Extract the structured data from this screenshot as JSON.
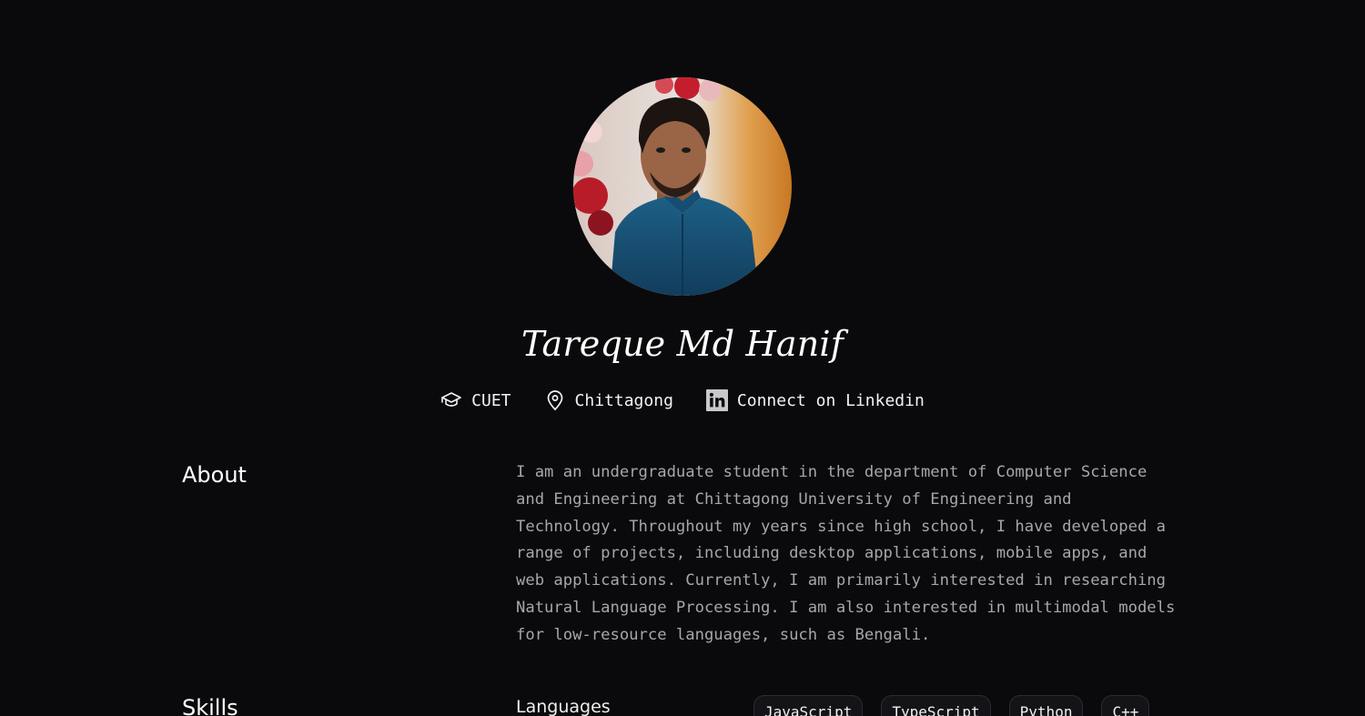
{
  "profile": {
    "name": "Tareque Md Hanif",
    "avatar_alt": "profile photo",
    "institution": "CUET",
    "location": "Chittagong",
    "linkedin_label": "Connect on Linkedin"
  },
  "icons": {
    "institution": "graduation-cap-icon",
    "location": "map-pin-icon",
    "linkedin": "linkedin-icon"
  },
  "about": {
    "title": "About",
    "text": "I am an undergraduate student in the department of Computer Science and Engineering at Chittagong University of Engineering and Technology. Throughout my years since high school, I have developed a range of projects, including desktop applications, mobile apps, and web applications. Currently, I am primarily interested in researching Natural Language Processing. I am also interested in multimodal models for low-resource languages, such as Bengali."
  },
  "skills": {
    "title": "Skills",
    "groups": [
      {
        "label": "Languages",
        "items": [
          "JavaScript",
          "TypeScript",
          "Python",
          "C++"
        ]
      }
    ]
  },
  "colors": {
    "background": "#0a0a0c",
    "text_primary": "#ffffff",
    "text_muted": "#a7a7ab",
    "chip_border": "#2b2b30"
  }
}
